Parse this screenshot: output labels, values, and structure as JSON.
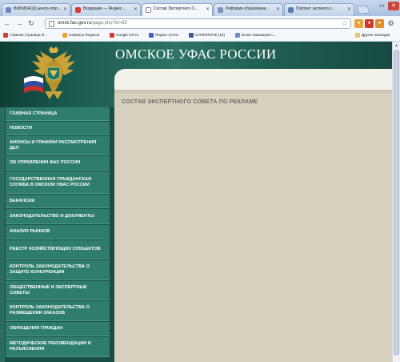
{
  "browser": {
    "tabs": [
      {
        "title": "ВИКЫБАОД центр-спор..."
      },
      {
        "title": "Входящие — Яндекс..."
      },
      {
        "title": "Состав Экспертного С..."
      },
      {
        "title": "Реформа образовани..."
      },
      {
        "title": "Портрет эксперта с..."
      }
    ],
    "url_domain": "omsk.fas.gov.ru",
    "url_path": "/page.php?id=85",
    "bookmarks": [
      {
        "label": "Главная страница Я...",
        "color": "#d0402f"
      },
      {
        "label": "Сервисы Яндекса",
        "color": "#e9a33a"
      },
      {
        "label": "Google почта",
        "color": "#d13b2e"
      },
      {
        "label": "Яндекс.почта",
        "color": "#3b66b4"
      },
      {
        "label": "СУПЕРЛУНЕ (10)",
        "color": "#3b5998"
      },
      {
        "label": "Блокс Кавказцев с...",
        "color": "#6f8fbf"
      }
    ],
    "other_bookmarks": "Другие закладки"
  },
  "header": {
    "title": "ОМСКОЕ УФАС РОССИИ"
  },
  "sidebar": {
    "items": [
      {
        "label": "ГЛАВНАЯ СТРАНИЦА"
      },
      {
        "label": "НОВОСТИ"
      },
      {
        "label": "АНОНСЫ И ГРАФИКИ РАССМОТРЕНИЯ ДЕЛ"
      },
      {
        "label": "ОБ УПРАВЛЕНИИ ФАС РОССИИ"
      },
      {
        "label": "ГОСУДАРСТВЕННАЯ ГРАЖДАНСКАЯ СЛУЖБА В ОМСКОМ УФАС РОССИИ"
      },
      {
        "label": "ВАКАНСИИ"
      },
      {
        "label": "ЗАКОНОДАТЕЛЬСТВО И ДОКУМЕНТЫ"
      },
      {
        "label": "АНАЛИЗ РЫНКОВ"
      },
      {
        "label": "РЕЕСТР ХОЗЯЙСТВУЮЩИХ СУБЪЕКТОВ"
      },
      {
        "label": "КОНТРОЛЬ ЗАКОНОДАТЕЛЬСТВА О ЗАЩИТЕ КОНКУРЕНЦИИ"
      },
      {
        "label": "ОБЩЕСТВЕННЫЕ И ЭКСПЕРТНЫЕ СОВЕТЫ"
      },
      {
        "label": "КОНТРОЛЬ ЗАКОНОДАТЕЛЬСТВА О РАЗМЕЩЕНИИ ЗАКАЗОВ"
      },
      {
        "label": "ОБРАЩЕНИЯ ГРАЖДАН"
      },
      {
        "label": "МЕТОДИЧЕСКИЕ РЕКОМЕНДАЦИИ И РАЗЪЯСНЕНИЯ"
      }
    ]
  },
  "content": {
    "title": "СОСТАВ ЭКСПЕРТНОГО СОВЕТА ПО РЕКЛАМЕ"
  }
}
